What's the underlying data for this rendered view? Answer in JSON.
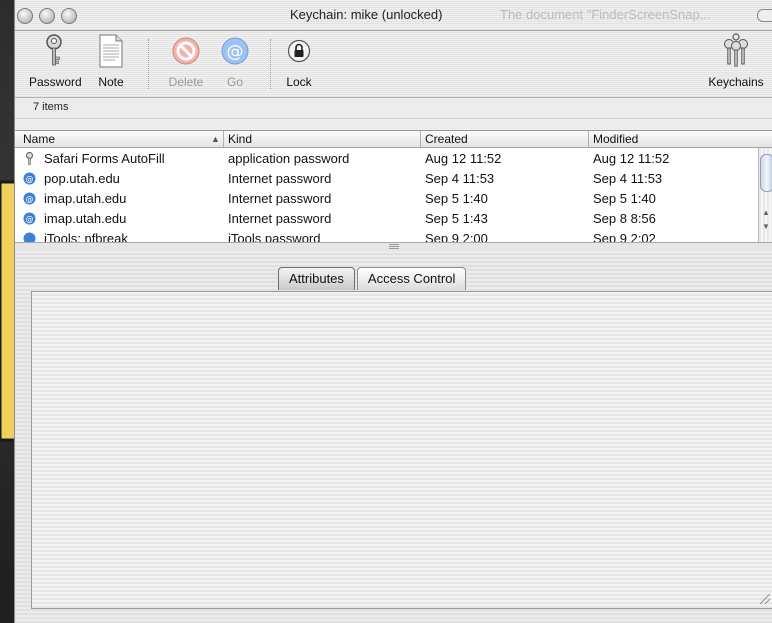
{
  "window": {
    "title": "Keychain: mike (unlocked)",
    "ghost_title": "The document \"FinderScreenSnap..."
  },
  "toolbar": {
    "items": [
      {
        "label": "Password",
        "icon": "key-icon",
        "enabled": true
      },
      {
        "label": "Note",
        "icon": "note-icon",
        "enabled": true
      },
      {
        "label": "Delete",
        "icon": "delete-icon",
        "enabled": false
      },
      {
        "label": "Go",
        "icon": "at-sign-icon",
        "enabled": false
      },
      {
        "label": "Lock",
        "icon": "lock-icon",
        "enabled": true
      },
      {
        "label": "Keychains",
        "icon": "keychains-icon",
        "enabled": true
      }
    ]
  },
  "list": {
    "count_text": "7 items",
    "columns": [
      "Name",
      "Kind",
      "Created",
      "Modified"
    ],
    "sort_column": "Name",
    "rows": [
      {
        "name": "Safari Forms AutoFill",
        "kind": "application password",
        "created": "Aug 12  11:52",
        "modified": "Aug 12  11:52",
        "icon": "key-icon"
      },
      {
        "name": "pop.utah.edu",
        "kind": "Internet password",
        "created": "Sep 4  11:53",
        "modified": "Sep 4  11:53",
        "icon": "internet-icon"
      },
      {
        "name": "imap.utah.edu",
        "kind": "Internet password",
        "created": "Sep 5  1:40",
        "modified": "Sep 5  1:40",
        "icon": "internet-icon"
      },
      {
        "name": "imap.utah.edu",
        "kind": "Internet password",
        "created": "Sep 5  1:43",
        "modified": "Sep 8  8:56",
        "icon": "internet-icon"
      },
      {
        "name": "iTools: nfbreak",
        "kind": "iTools password",
        "created": "Sep 9  2:00",
        "modified": "Sep 9  2:02",
        "icon": "internet-icon"
      }
    ]
  },
  "detail": {
    "tabs": [
      {
        "label": "Attributes",
        "active": true
      },
      {
        "label": "Access Control",
        "active": false
      }
    ]
  },
  "colors": {
    "desktop": "#2b2b2b",
    "sticky_yellow": "#f0cf5c",
    "internet_icon_blue": "#3b7fd8",
    "delete_red": "#e05a4e"
  }
}
